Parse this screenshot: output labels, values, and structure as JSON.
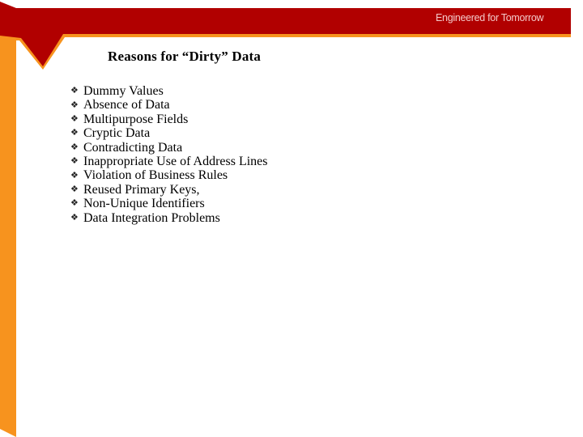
{
  "header": {
    "tagline": "Engineered for Tomorrow",
    "colors": {
      "band_red": "#b10000",
      "accent_orange": "#f7931e"
    }
  },
  "slide": {
    "title": "Reasons for “Dirty” Data",
    "bullet_icon": "diamond-four-dots-icon",
    "bullet_glyph": "❖",
    "items": [
      "Dummy Values",
      "Absence of Data",
      "Multipurpose Fields",
      "Cryptic Data",
      "Contradicting Data",
      "Inappropriate Use of Address Lines",
      "Violation of Business Rules",
      "Reused Primary Keys,",
      "Non-Unique Identifiers",
      "Data Integration Problems"
    ]
  }
}
